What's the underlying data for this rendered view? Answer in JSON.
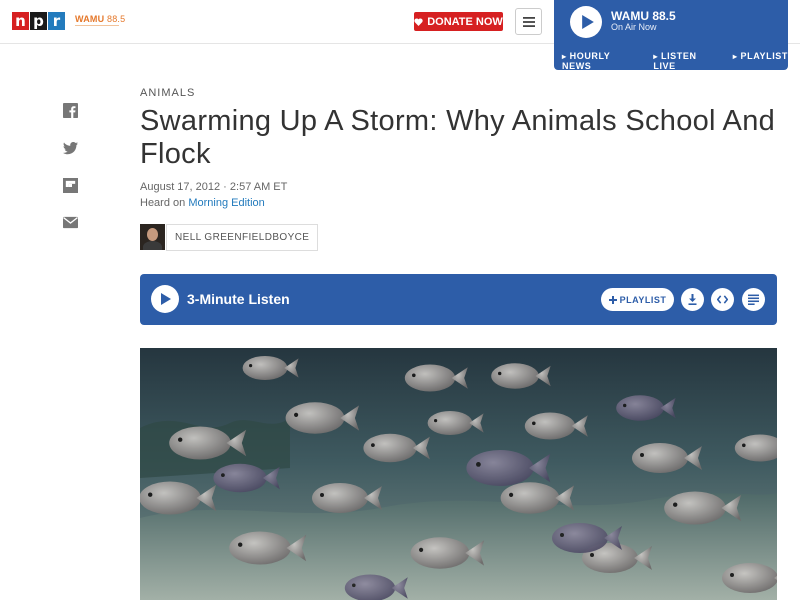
{
  "header": {
    "logo_letters": [
      "n",
      "p",
      "r"
    ],
    "station_name": "WAMU",
    "station_freq": "88.5",
    "donate_label": "DONATE NOW",
    "icons": {
      "donate": "heart-icon",
      "menu": "hamburger-menu-icon"
    }
  },
  "live_player": {
    "title": "WAMU 88.5",
    "status": "On Air Now",
    "links": [
      "HOURLY NEWS",
      "LISTEN LIVE",
      "PLAYLIST"
    ],
    "icon": "play-icon",
    "background": "#2d5da8"
  },
  "share": [
    "facebook-icon",
    "twitter-icon",
    "flipboard-icon",
    "email-icon"
  ],
  "article": {
    "section": "ANIMALS",
    "headline": "Swarming Up A Storm: Why Animals School And Flock",
    "date": "August 17, 2012 · 2:57 AM ET",
    "heard_prefix": "Heard on",
    "heard_show": "Morning Edition",
    "author": "NELL GREENFIELDBOYCE"
  },
  "audio": {
    "title": "3-Minute Listen",
    "playlist_label": "PLAYLIST",
    "icons": [
      "play-icon",
      "plus-icon",
      "download-icon",
      "embed-icon",
      "transcript-icon"
    ],
    "background": "#2d5da8"
  },
  "colors": {
    "brand_red": "#d62021",
    "brand_blue": "#237bbd",
    "accent_orange": "#e5782b"
  }
}
